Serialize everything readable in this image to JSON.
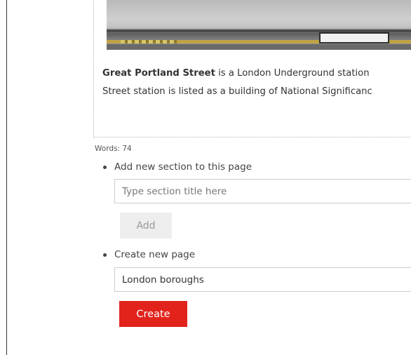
{
  "article": {
    "image_alt": "Great Portland Street station platform",
    "text_bold": "Great Portland Street",
    "text_line1_rest": " is a London Underground station",
    "text_line2": "Street station is listed as a building of National Significanc"
  },
  "word_count": "Words: 74",
  "add_section": {
    "label": "Add new section to this page",
    "placeholder": "Type section title here",
    "value": "",
    "button_label": "Add"
  },
  "create_page": {
    "label": "Create new page",
    "value": "London boroughs",
    "button_label": "Create"
  },
  "colors": {
    "primary_button": "#e1231c",
    "disabled_button": "#eeeeee"
  }
}
